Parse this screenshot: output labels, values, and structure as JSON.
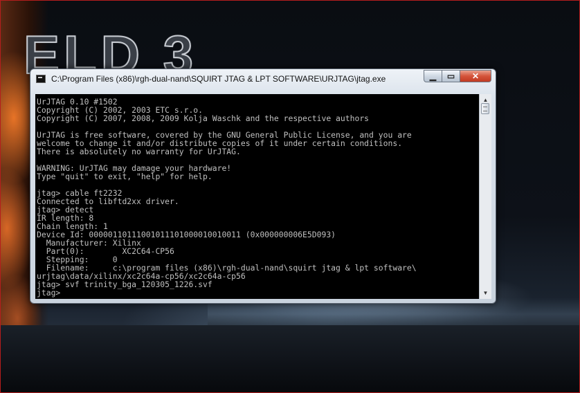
{
  "window": {
    "title": "C:\\Program Files (x86)\\rgh-dual-nand\\SQUIRT JTAG & LPT SOFTWARE\\URJTAG\\jtag.exe",
    "minimize_glyph": "▁",
    "maximize_glyph": "▭",
    "close_glyph": "✕"
  },
  "wallpaper": {
    "logo_text": "ELD 3"
  },
  "console": {
    "lines": [
      "UrJTAG 0.10 #1502",
      "Copyright (C) 2002, 2003 ETC s.r.o.",
      "Copyright (C) 2007, 2008, 2009 Kolja Waschk and the respective authors",
      "",
      "UrJTAG is free software, covered by the GNU General Public License, and you are",
      "welcome to change it and/or distribute copies of it under certain conditions.",
      "There is absolutely no warranty for UrJTAG.",
      "",
      "WARNING: UrJTAG may damage your hardware!",
      "Type \"quit\" to exit, \"help\" for help.",
      "",
      "jtag> cable ft2232",
      "Connected to libftd2xx driver.",
      "jtag> detect",
      "IR length: 8",
      "Chain length: 1",
      "Device Id: 00000110111001011101000010010011 (0x000000006E5D093)",
      "  Manufacturer: Xilinx",
      "  Part(0):        XC2C64-CP56",
      "  Stepping:     0",
      "  Filename:     c:\\program files (x86)\\rgh-dual-nand\\squirt jtag & lpt software\\",
      "urjtag\\data/xilinx/xc2c64a-cp56/xc2c64a-cp56",
      "jtag> svf trinity_bga_120305_1226.svf",
      "jtag>"
    ]
  },
  "scrollbar": {
    "up_glyph": "▲",
    "down_glyph": "▼"
  },
  "colors": {
    "console_bg": "#000000",
    "console_text": "#c0c0c0",
    "close_button": "#c13a22"
  }
}
